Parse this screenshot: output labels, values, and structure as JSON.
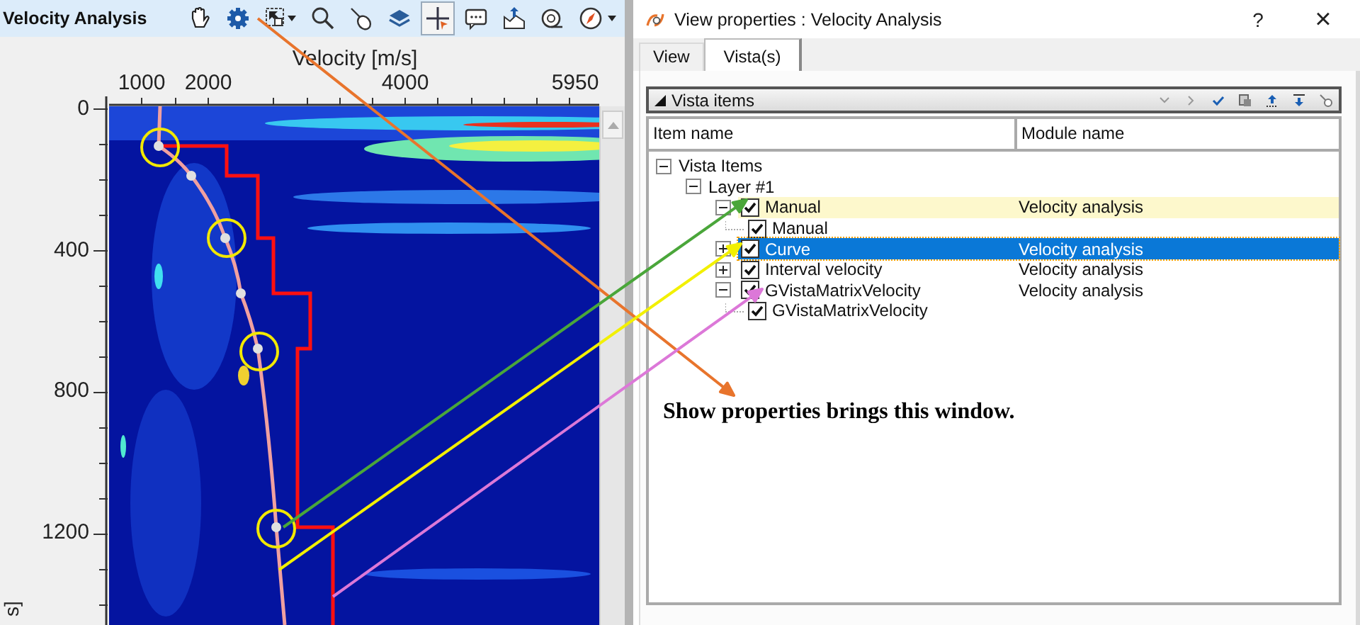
{
  "plot_window": {
    "title": "Velocity Analysis",
    "toolbar": [
      {
        "kind": "hand",
        "pressed": false
      },
      {
        "kind": "gear",
        "pressed": false
      },
      {
        "kind": "select",
        "pressed": false
      },
      {
        "kind": "zoom",
        "pressed": false
      },
      {
        "kind": "pick",
        "pressed": false
      },
      {
        "kind": "layers",
        "pressed": false
      },
      {
        "kind": "crosshair",
        "pressed": true
      },
      {
        "kind": "comment",
        "pressed": false
      },
      {
        "kind": "export",
        "pressed": false
      },
      {
        "kind": "snapshot",
        "pressed": false
      },
      {
        "kind": "compass",
        "pressed": false
      }
    ],
    "x_axis_title": "Velocity [m/s]",
    "x_ticks": [
      "1000",
      "2000",
      "4000",
      "5950"
    ],
    "y_ticks": [
      "0",
      "400",
      "800",
      "1200"
    ],
    "y_axis_title": "s]"
  },
  "dialog": {
    "title": "View properties : Velocity Analysis",
    "help": "?",
    "close": "×",
    "tabs": [
      {
        "label": "View",
        "selected": false
      },
      {
        "label": "Vista(s)",
        "selected": true
      }
    ],
    "group_title": "Vista items",
    "columns": [
      "Item name",
      "Module name"
    ],
    "tree": [
      {
        "kind": "group",
        "label": "Vista Items",
        "expanded": true,
        "children": [
          {
            "kind": "group",
            "label": "Layer  #1",
            "expanded": true,
            "children": [
              {
                "kind": "item",
                "label": "Manual",
                "module": "Velocity analysis",
                "checked": true,
                "expanded": true,
                "selected": false,
                "highlighted": true,
                "children": [
                  {
                    "kind": "leaf",
                    "label": "Manual",
                    "checked": true,
                    "selected": false,
                    "highlighted": false
                  }
                ]
              },
              {
                "kind": "item",
                "label": "Curve",
                "module": "Velocity analysis",
                "checked": true,
                "expanded": false,
                "selected": true,
                "highlighted": false
              },
              {
                "kind": "item",
                "label": "Interval velocity",
                "module": "Velocity analysis",
                "checked": true,
                "expanded": false,
                "selected": false,
                "highlighted": false
              },
              {
                "kind": "item",
                "label": "GVistaMatrixVelocity",
                "module": "Velocity analysis",
                "checked": true,
                "expanded": true,
                "selected": false,
                "highlighted": false,
                "children": [
                  {
                    "kind": "leaf",
                    "label": "GVistaMatrixVelocity",
                    "checked": true,
                    "selected": false,
                    "highlighted": false
                  }
                ]
              }
            ]
          }
        ]
      }
    ]
  },
  "annotation": "Show properties brings this window.",
  "callouts": [
    {
      "color": "#e8742c"
    },
    {
      "color": "#4aa63a"
    },
    {
      "color": "#f2f000"
    },
    {
      "color": "#dc78d8"
    }
  ]
}
